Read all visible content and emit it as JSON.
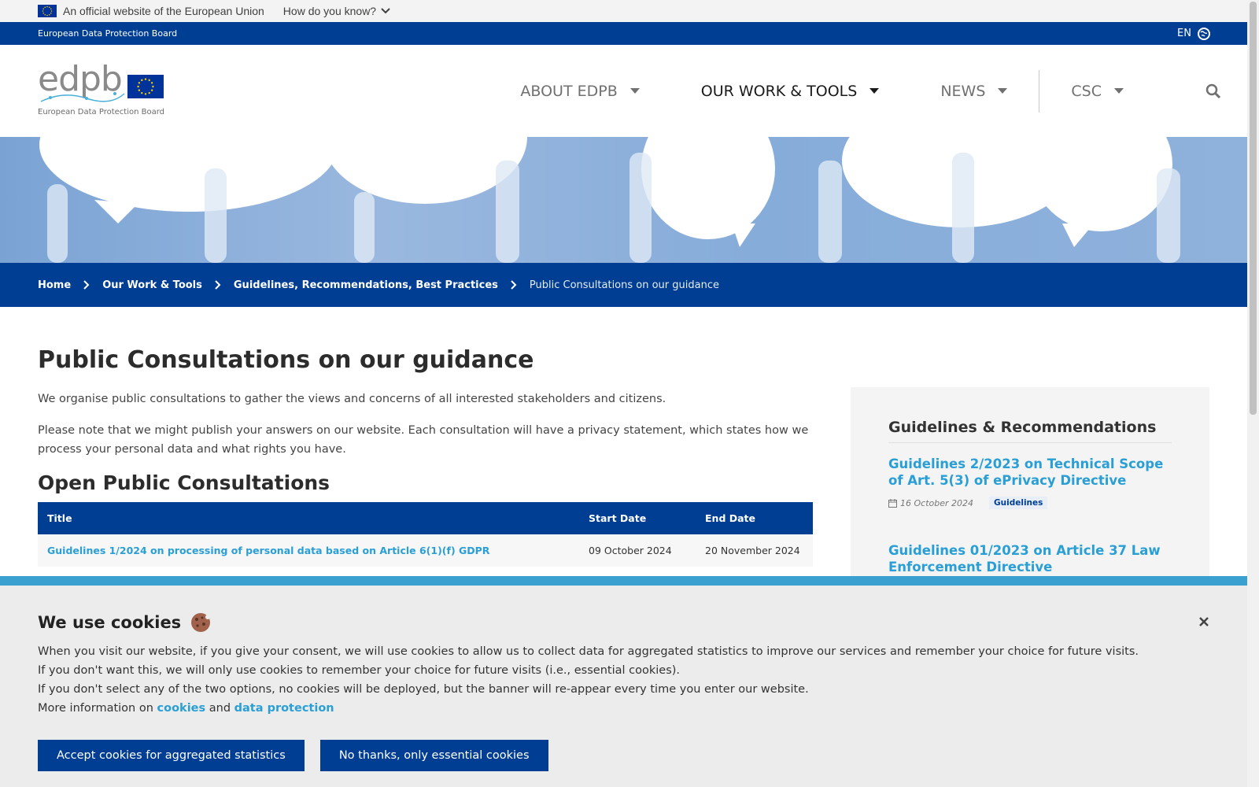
{
  "eu_bar": {
    "official_text": "An official website of the European Union",
    "how_know": "How do you know?"
  },
  "top_strip": {
    "org_name": "European Data Protection Board",
    "lang": "EN"
  },
  "logo": {
    "wordmark": "edpb",
    "subtitle": "European Data Protection Board"
  },
  "nav": {
    "items": [
      {
        "label": "ABOUT EDPB"
      },
      {
        "label": "OUR WORK & TOOLS"
      },
      {
        "label": "NEWS"
      },
      {
        "label": "CSC"
      }
    ]
  },
  "breadcrumb": {
    "items": [
      "Home",
      "Our Work & Tools",
      "Guidelines, Recommendations, Best Practices"
    ],
    "current": "Public Consultations on our guidance"
  },
  "main": {
    "title": "Public Consultations on our guidance",
    "para1": "We organise public consultations to gather the views and concerns of all interested stakeholders and citizens.",
    "para2": "Please note that we might publish your answers on our website. Each consultation will have a privacy statement, which states how we process your personal data and what rights you have.",
    "section_title": "Open Public Consultations",
    "table": {
      "headers": [
        "Title",
        "Start Date",
        "End Date"
      ],
      "rows": [
        {
          "title": "Guidelines 1/2024 on processing of personal data based on Article 6(1)(f) GDPR",
          "start": "09 October 2024",
          "end": "20 November 2024"
        }
      ]
    }
  },
  "sidebar": {
    "title": "Guidelines & Recommendations",
    "items": [
      {
        "title": "Guidelines 2/2023 on Technical Scope of Art. 5(3) of ePrivacy Directive",
        "date": "16 October 2024",
        "badge": "Guidelines"
      },
      {
        "title": "Guidelines 01/2023 on Article 37 Law Enforcement Directive"
      }
    ]
  },
  "cookie": {
    "title": "We use cookies",
    "line1": "When you visit our website, if you give your consent, we will use cookies to allow us to collect data for aggregated statistics to improve our services and remember your choice for future visits.",
    "line2": "If you don't want this, we will only use cookies to remember your choice for future visits (i.e., essential cookies).",
    "line3": "If you don't select any of the two options, no cookies will be deployed, but the banner will re-appear every time you enter our website.",
    "more_prefix": "More information on",
    "cookies_link": "cookies",
    "and": "and",
    "dp_link": "data protection",
    "accept_label": "Accept cookies for aggregated statistics",
    "reject_label": "No thanks, only essential cookies"
  },
  "colors": {
    "primary": "#003e93",
    "link": "#2a9fd6",
    "banner_accent": "#3aa0d0"
  }
}
